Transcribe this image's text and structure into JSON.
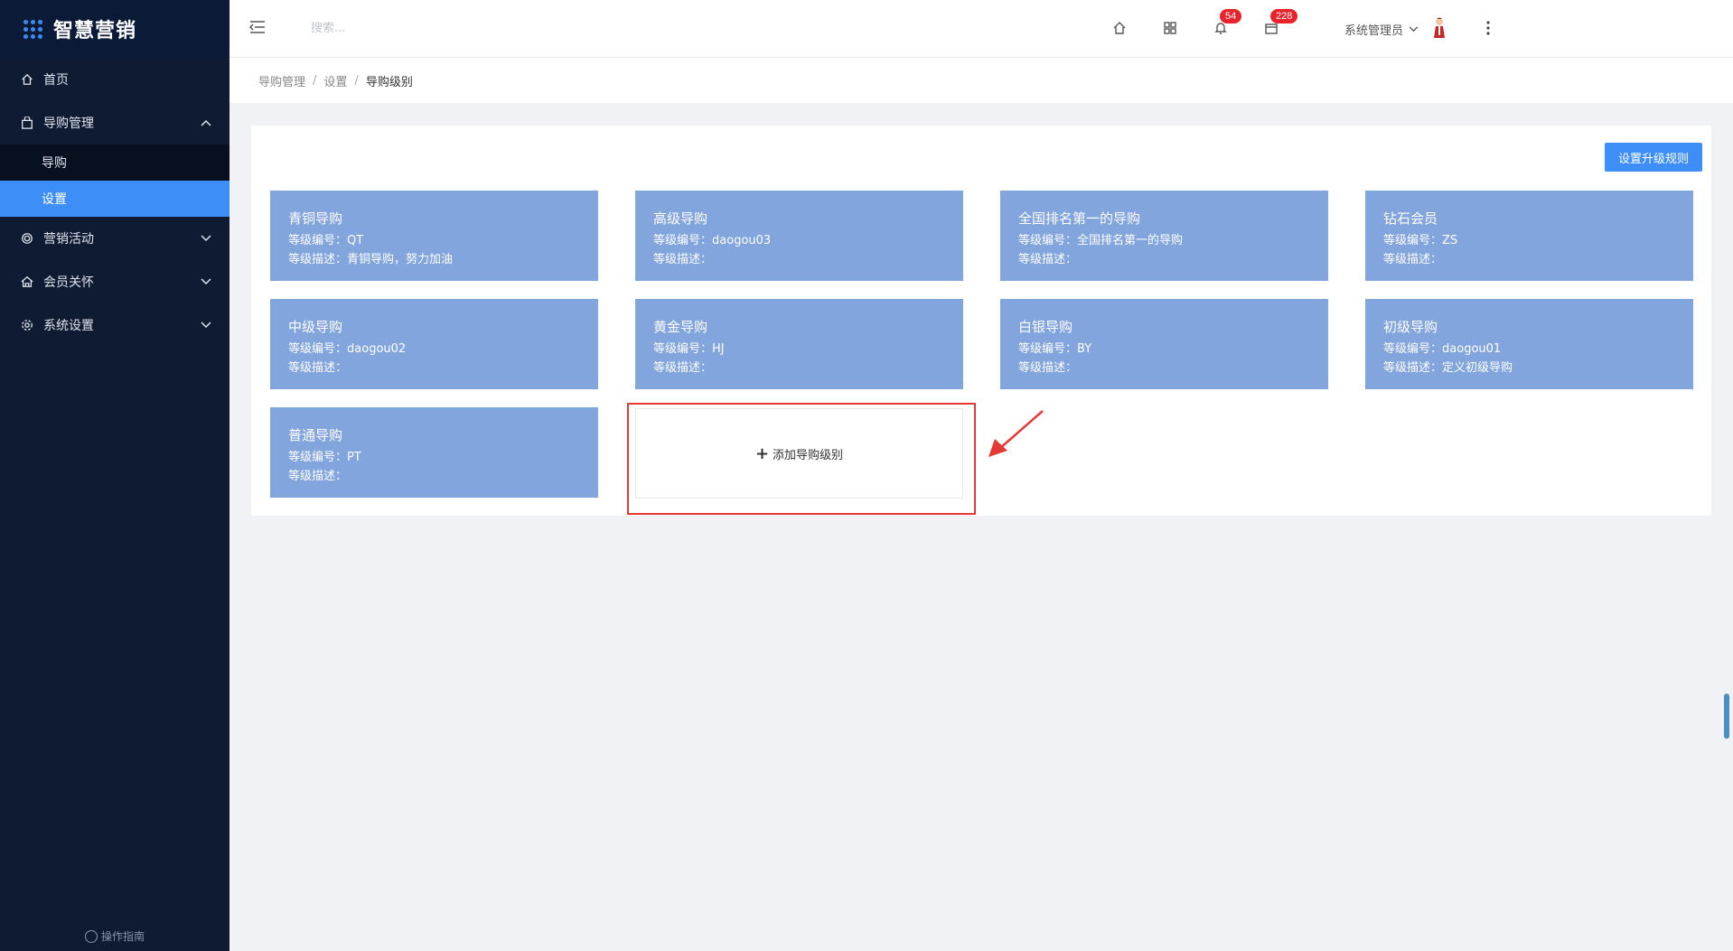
{
  "app": {
    "name": "智慧营销",
    "footer_link": "操作指南"
  },
  "sidebar": {
    "items": [
      {
        "label": "首页",
        "icon": "home-icon"
      },
      {
        "label": "导购管理",
        "icon": "bag-icon",
        "expanded": true,
        "children": [
          {
            "label": "导购",
            "active": false
          },
          {
            "label": "设置",
            "active": true
          }
        ]
      },
      {
        "label": "营销活动",
        "icon": "target-icon"
      },
      {
        "label": "会员关怀",
        "icon": "house-icon"
      },
      {
        "label": "系统设置",
        "icon": "gear-icon"
      }
    ]
  },
  "header": {
    "search_placeholder": "搜索...",
    "notifications_count": "54",
    "messages_count": "228",
    "user_name": "系统管理员"
  },
  "breadcrumb": {
    "items": [
      "导购管理",
      "设置",
      "导购级别"
    ],
    "separator": "/"
  },
  "main": {
    "set_rules_button": "设置升级规则",
    "code_label": "等级编号：",
    "desc_label": "等级描述：",
    "levels": [
      {
        "name": "青铜导购",
        "code": "QT",
        "desc": "青铜导购，努力加油"
      },
      {
        "name": "高级导购",
        "code": "daogou03",
        "desc": ""
      },
      {
        "name": "全国排名第一的导购",
        "code": "全国排名第一的导购",
        "desc": ""
      },
      {
        "name": "钻石会员",
        "code": "ZS",
        "desc": ""
      },
      {
        "name": "中级导购",
        "code": "daogou02",
        "desc": ""
      },
      {
        "name": "黄金导购",
        "code": "HJ",
        "desc": ""
      },
      {
        "name": "白银导购",
        "code": "BY",
        "desc": ""
      },
      {
        "name": "初级导购",
        "code": "daogou01",
        "desc": "定义初级导购"
      },
      {
        "name": "普通导购",
        "code": "PT",
        "desc": ""
      }
    ],
    "add_level_label": "添加导购级别"
  },
  "colors": {
    "sidebar_bg": "#0f1b33",
    "accent": "#3e8ef7",
    "card_bg": "#82a5dd",
    "badge": "#e8242b",
    "highlight": "#e53935"
  }
}
